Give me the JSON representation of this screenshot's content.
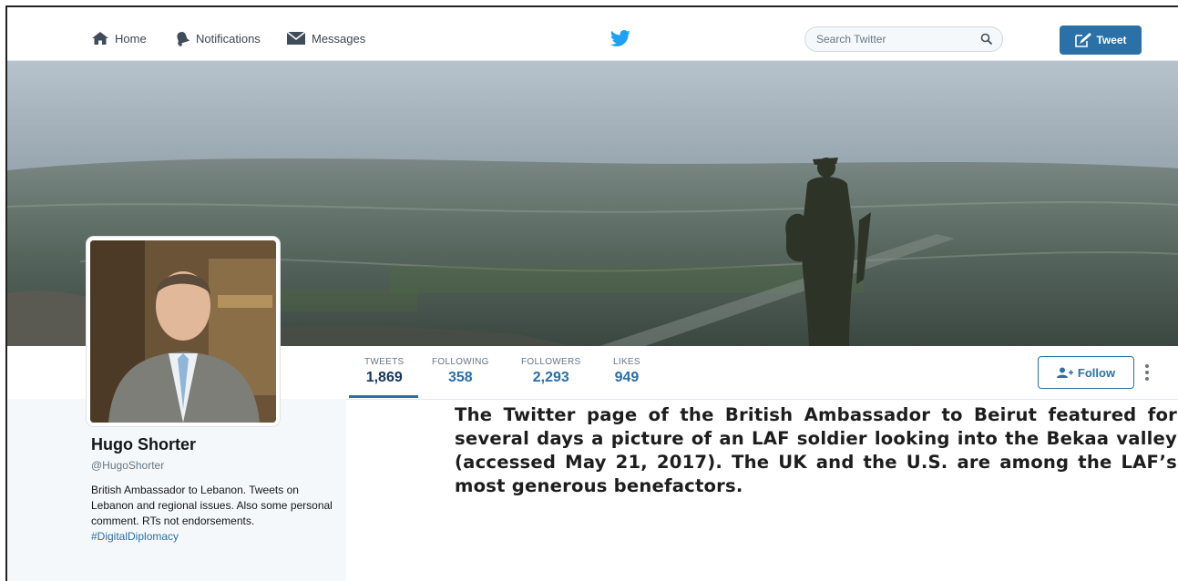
{
  "nav": {
    "home_label": "Home",
    "notifications_label": "Notifications",
    "messages_label": "Messages",
    "search_placeholder": "Search Twitter",
    "tweet_button_label": "Tweet"
  },
  "profile": {
    "name": "Hugo Shorter",
    "handle": "@HugoShorter",
    "bio": "British Ambassador to Lebanon. Tweets on Lebanon and regional issues. Also some personal comment. RTs not endorsements.",
    "bio_hashtag": "#DigitalDiplomacy"
  },
  "stats": [
    {
      "label": "TWEETS",
      "value": "1,869"
    },
    {
      "label": "FOLLOWING",
      "value": "358"
    },
    {
      "label": "FOLLOWERS",
      "value": "2,293"
    },
    {
      "label": "LIKES",
      "value": "949"
    }
  ],
  "follow_button_label": "Follow",
  "caption": "The Twitter page of the British Ambassador to Beirut featured for several days a picture of an LAF soldier looking into the Bekaa valley (accessed May 21, 2017). The UK and the U.S. are among the LAF’s most generous benefactors.",
  "colors": {
    "accent": "#2b71a8",
    "twitter_blue": "#1da1f2",
    "stat_value": "#2b6fa5"
  },
  "icons": [
    "home-icon",
    "bell-icon",
    "envelope-icon",
    "twitter-bird-icon",
    "search-icon",
    "compose-icon",
    "add-user-icon",
    "more-vertical-icon"
  ]
}
